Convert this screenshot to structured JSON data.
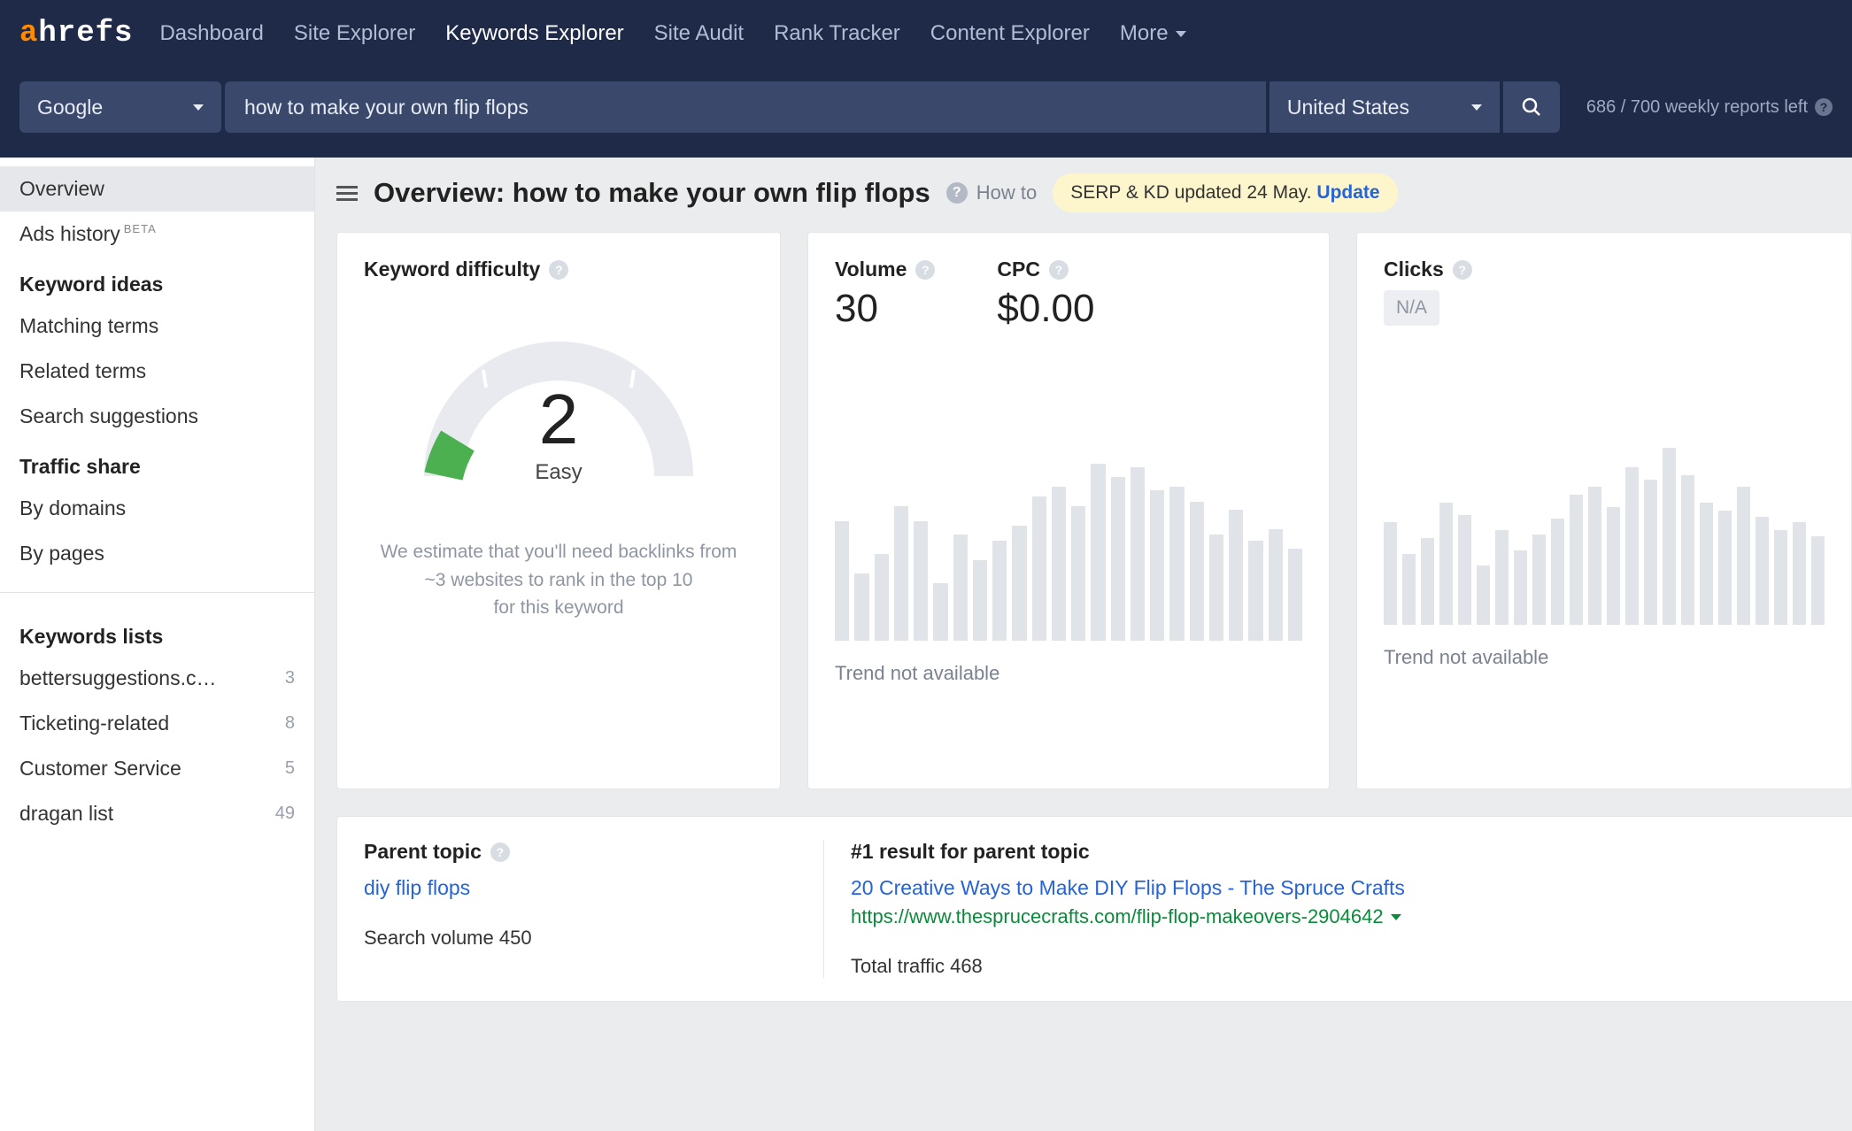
{
  "nav": {
    "logo_a": "a",
    "logo_rest": "hrefs",
    "items": [
      "Dashboard",
      "Site Explorer",
      "Keywords Explorer",
      "Site Audit",
      "Rank Tracker",
      "Content Explorer",
      "More"
    ],
    "active_index": 2
  },
  "searchbar": {
    "engine": "Google",
    "query": "how to make your own flip flops",
    "country": "United States",
    "reports_left": "686 / 700 weekly reports left"
  },
  "sidebar": {
    "overview": "Overview",
    "ads_history": "Ads history",
    "beta": "BETA",
    "keyword_ideas_heading": "Keyword ideas",
    "keyword_ideas": [
      "Matching terms",
      "Related terms",
      "Search suggestions"
    ],
    "traffic_share_heading": "Traffic share",
    "traffic_share": [
      "By domains",
      "By pages"
    ],
    "keywords_lists_heading": "Keywords lists",
    "lists": [
      {
        "name": "bettersuggestions.c…",
        "count": "3"
      },
      {
        "name": "Ticketing-related",
        "count": "8"
      },
      {
        "name": "Customer Service",
        "count": "5"
      },
      {
        "name": "dragan list",
        "count": "49"
      }
    ]
  },
  "header": {
    "title": "Overview: how to make your own flip flops",
    "howto": "How to",
    "update_text": "SERP & KD updated 24 May. ",
    "update_link": "Update"
  },
  "kd": {
    "label": "Keyword difficulty",
    "value": "2",
    "rating": "Easy",
    "desc1": "We estimate that you'll need backlinks from",
    "desc2": "~3 websites to rank in the top 10",
    "desc3": "for this keyword"
  },
  "vol": {
    "volume_label": "Volume",
    "volume_value": "30",
    "cpc_label": "CPC",
    "cpc_value": "$0.00",
    "trend_na": "Trend not available"
  },
  "clicks": {
    "label": "Clicks",
    "na": "N/A",
    "trend_na": "Trend not available"
  },
  "parent": {
    "heading": "Parent topic",
    "topic": "diy flip flops",
    "search_volume": "Search volume 450",
    "result_heading": "#1 result for parent topic",
    "result_title": "20 Creative Ways to Make DIY Flip Flops - The Spruce Crafts",
    "result_url": "https://www.thesprucecrafts.com/flip-flop-makeovers-2904642",
    "total_traffic": "Total traffic 468"
  },
  "chart_data": {
    "type": "bar",
    "note": "relative bar heights only — axes/values not shown in UI",
    "volume_bars_rel": [
      62,
      35,
      45,
      70,
      62,
      30,
      55,
      42,
      52,
      60,
      75,
      80,
      70,
      92,
      85,
      90,
      78,
      80,
      72,
      55,
      68,
      52,
      58,
      48
    ],
    "clicks_bars_rel": [
      52,
      36,
      44,
      62,
      56,
      30,
      48,
      38,
      46,
      54,
      66,
      70,
      60,
      80,
      74,
      90,
      76,
      62,
      58,
      70,
      55,
      48,
      52,
      45
    ]
  }
}
